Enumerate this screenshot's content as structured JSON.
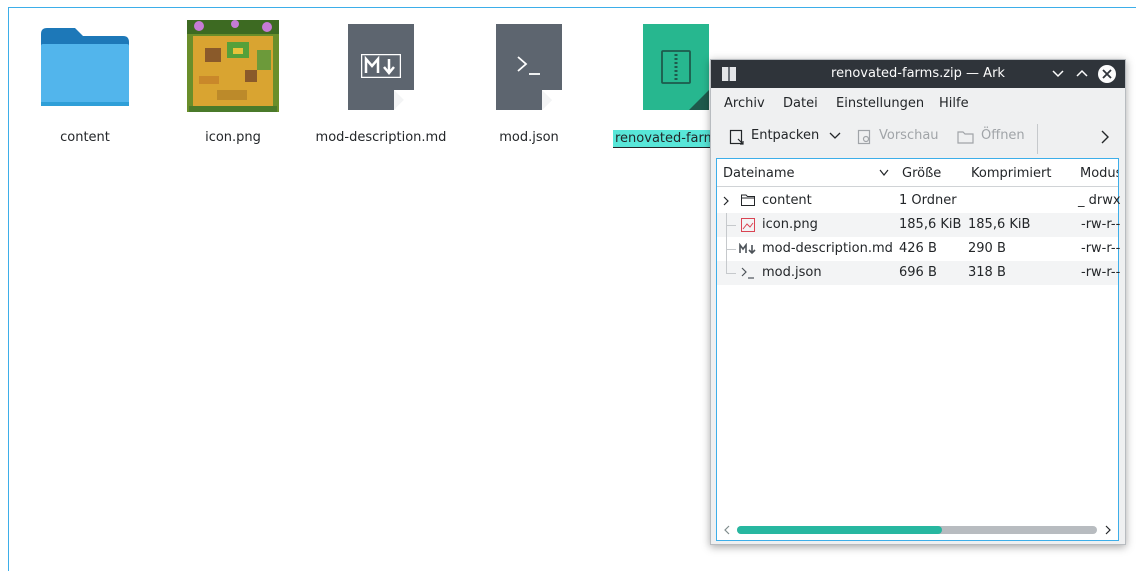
{
  "files": [
    {
      "name": "content",
      "icon": "folder-icon"
    },
    {
      "name": "icon.png",
      "icon": "image-thumbnail"
    },
    {
      "name": "mod-description.md",
      "icon": "markdown-file-icon"
    },
    {
      "name": "mod.json",
      "icon": "json-file-icon"
    },
    {
      "name": "renovated-farm",
      "icon": "zip-archive-icon",
      "selected": true
    }
  ],
  "ark": {
    "title": "renovated-farms.zip — Ark",
    "menu": [
      "Archiv",
      "Datei",
      "Einstellungen",
      "Hilfe"
    ],
    "toolbar": {
      "extract": "Entpacken",
      "preview": "Vorschau",
      "open": "Öffnen"
    },
    "columns": [
      "Dateiname",
      "Größe",
      "Komprimiert",
      "Modus"
    ],
    "rows": [
      {
        "name": "content",
        "size": "1 Ordner",
        "compressed": "",
        "mode": "_ drwx",
        "icon": "folder-icon"
      },
      {
        "name": "icon.png",
        "size": "185,6 KiB",
        "compressed": "185,6 KiB",
        "mode": "-rw-r--",
        "icon": "image-icon"
      },
      {
        "name": "mod-description.md",
        "size": "426 B",
        "compressed": "290 B",
        "mode": "-rw-r--",
        "icon": "markdown-icon"
      },
      {
        "name": "mod.json",
        "size": "696 B",
        "compressed": "318 B",
        "mode": "-rw-r--",
        "icon": "terminal-icon"
      }
    ]
  },
  "colors": {
    "selection": "#58e6d8",
    "accent": "#3daee9",
    "titlebar": "#2f343a",
    "zip": "#27b78f",
    "folder": "#3daee9"
  }
}
